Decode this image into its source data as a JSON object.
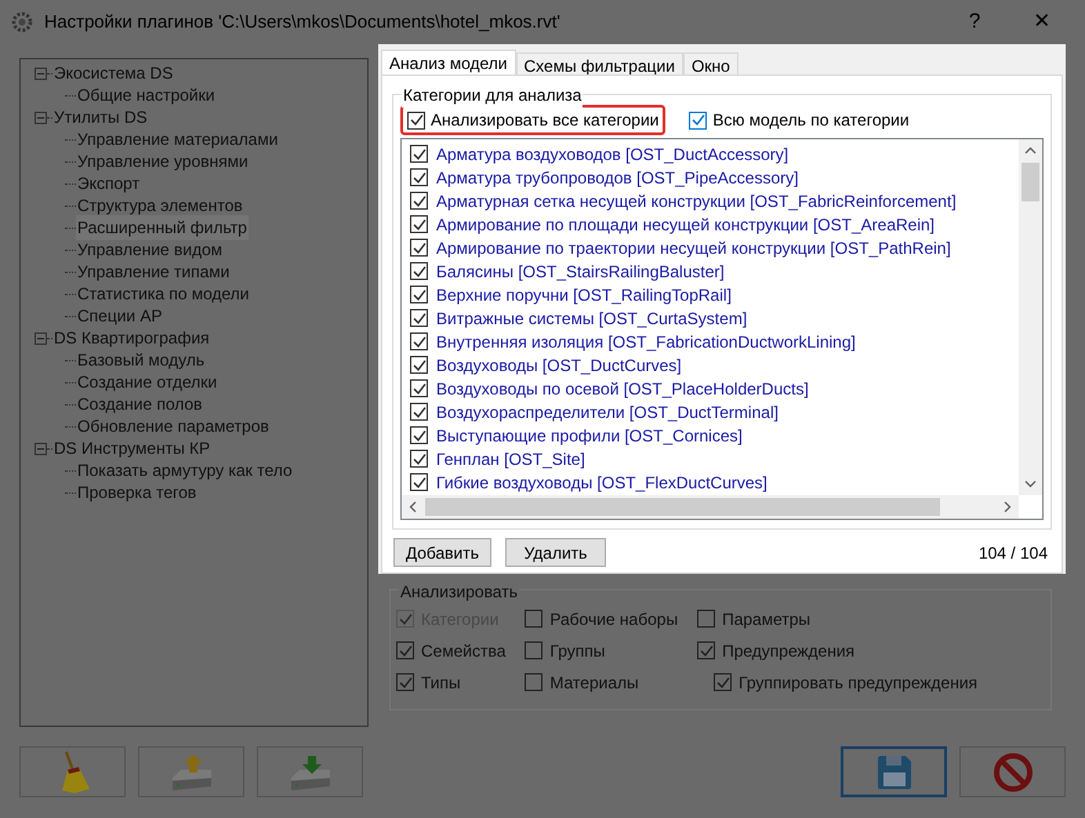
{
  "window": {
    "title": "Настройки плагинов 'C:\\Users\\mkos\\Documents\\hotel_mkos.rvt'",
    "help": "?",
    "close": "✕"
  },
  "tree": [
    {
      "label": "Экосистема DS",
      "expanded": true,
      "children": [
        {
          "label": "Общие настройки",
          "selected": false
        }
      ]
    },
    {
      "label": "Утилиты DS",
      "expanded": true,
      "children": [
        {
          "label": "Управление материалами",
          "selected": false
        },
        {
          "label": "Управление уровнями",
          "selected": false
        },
        {
          "label": "Экспорт",
          "selected": false
        },
        {
          "label": "Структура элементов",
          "selected": false
        },
        {
          "label": "Расширенный фильтр",
          "selected": true
        },
        {
          "label": "Управление видом",
          "selected": false
        },
        {
          "label": "Управление типами",
          "selected": false
        },
        {
          "label": "Статистика по модели",
          "selected": false
        },
        {
          "label": "Специи АР",
          "selected": false
        }
      ]
    },
    {
      "label": "DS Квартирография",
      "expanded": true,
      "children": [
        {
          "label": "Базовый модуль",
          "selected": false
        },
        {
          "label": "Создание отделки",
          "selected": false
        },
        {
          "label": "Создание полов",
          "selected": false
        },
        {
          "label": "Обновление параметров",
          "selected": false
        }
      ]
    },
    {
      "label": "DS Инструменты КР",
      "expanded": true,
      "children": [
        {
          "label": "Показать армутуру как тело",
          "selected": false
        },
        {
          "label": "Проверка тегов",
          "selected": false
        }
      ]
    }
  ],
  "tabs": [
    {
      "label": "Анализ модели",
      "selected": true
    },
    {
      "label": "Схемы фильтрации",
      "selected": false
    },
    {
      "label": "Окно",
      "selected": false
    }
  ],
  "categories_group": {
    "title": "Категории для анализа",
    "options": [
      {
        "label": "Анализировать все категории",
        "checked": true,
        "highlighted": true
      },
      {
        "label": "Всю модель по категории",
        "checked": true,
        "highlighted": false
      }
    ],
    "items": [
      {
        "label": "Арматура воздуховодов [OST_DuctAccessory]",
        "checked": true
      },
      {
        "label": "Арматура трубопроводов [OST_PipeAccessory]",
        "checked": true
      },
      {
        "label": "Арматурная сетка несущей конструкции [OST_FabricReinforcement]",
        "checked": true
      },
      {
        "label": "Армирование по площади несущей конструкции [OST_AreaRein]",
        "checked": true
      },
      {
        "label": "Армирование по траектории несущей конструкции [OST_PathRein]",
        "checked": true
      },
      {
        "label": "Балясины [OST_StairsRailingBaluster]",
        "checked": true
      },
      {
        "label": "Верхние поручни [OST_RailingTopRail]",
        "checked": true
      },
      {
        "label": "Витражные системы [OST_CurtaSystem]",
        "checked": true
      },
      {
        "label": "Внутренняя изоляция [OST_FabricationDuctworkLining]",
        "checked": true
      },
      {
        "label": "Воздуховоды [OST_DuctCurves]",
        "checked": true
      },
      {
        "label": "Воздуховоды по осевой [OST_PlaceHolderDucts]",
        "checked": true
      },
      {
        "label": "Воздухораспределители [OST_DuctTerminal]",
        "checked": true
      },
      {
        "label": "Выступающие профили [OST_Cornices]",
        "checked": true
      },
      {
        "label": "Генплан [OST_Site]",
        "checked": true
      },
      {
        "label": "Гибкие воздуховоды [OST_FlexDuctCurves]",
        "checked": true
      }
    ],
    "buttons": [
      "Добавить",
      "Удалить"
    ],
    "count": "104 / 104"
  },
  "analyze_group": {
    "title": "Анализировать",
    "columns": [
      [
        {
          "label": "Категории",
          "checked": true,
          "disabled": true
        },
        {
          "label": "Семейства",
          "checked": true,
          "disabled": false
        },
        {
          "label": "Типы",
          "checked": true,
          "disabled": false
        }
      ],
      [
        {
          "label": "Рабочие наборы",
          "checked": false,
          "disabled": false
        },
        {
          "label": "Группы",
          "checked": false,
          "disabled": false
        },
        {
          "label": "Материалы",
          "checked": false,
          "disabled": false
        }
      ],
      [
        {
          "label": "Параметры",
          "checked": false,
          "disabled": false
        },
        {
          "label": "Предупреждения",
          "checked": true,
          "disabled": false
        },
        {
          "label": "Группировать предупреждения",
          "checked": true,
          "disabled": false
        }
      ]
    ]
  },
  "bottom_buttons": [
    {
      "kind": "broom",
      "focused": false
    },
    {
      "kind": "export",
      "focused": false
    },
    {
      "kind": "import",
      "focused": false
    },
    {
      "kind": "save",
      "focused": true
    },
    {
      "kind": "cancel",
      "focused": false
    }
  ]
}
